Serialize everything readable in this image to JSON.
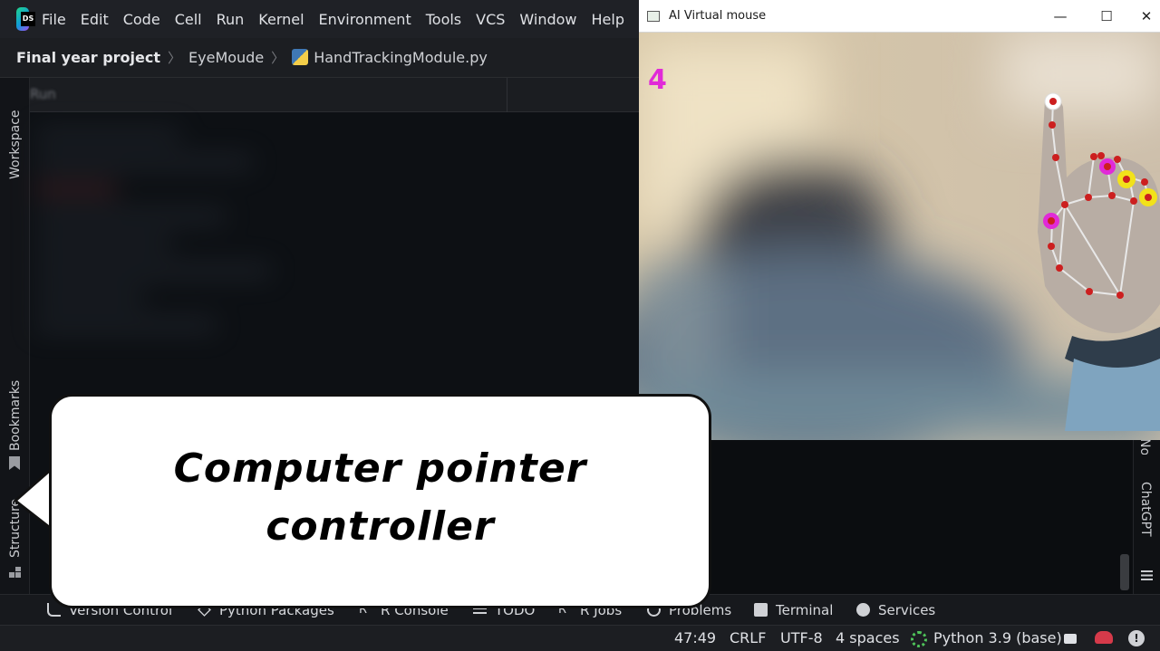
{
  "menubar": {
    "app_icon": "dataspell-logo-icon",
    "items": [
      "File",
      "Edit",
      "Code",
      "Cell",
      "Run",
      "Kernel",
      "Environment",
      "Tools",
      "VCS",
      "Window",
      "Help"
    ]
  },
  "breadcrumb": {
    "project": "Final year project",
    "folder": "EyeMoude",
    "file": "HandTrackingModule.py",
    "file_icon": "python-file-icon"
  },
  "editor": {
    "run_tab": "Run"
  },
  "sidebar_left": {
    "workspace": "Workspace",
    "bookmarks": "Bookmarks",
    "structure": "Structure"
  },
  "sidebar_right": {
    "notifications": "Notifications",
    "chatgpt": "ChatGPT"
  },
  "video_window": {
    "title": "AI Virtual mouse",
    "frame_label": "4",
    "controls": [
      "minimize",
      "maximize",
      "close"
    ]
  },
  "toolbar": {
    "items": [
      {
        "label": "Version Control",
        "icon": "branch-icon"
      },
      {
        "label": "Python Packages",
        "icon": "layers-icon"
      },
      {
        "label": "R Console",
        "icon": "r-console-icon"
      },
      {
        "label": "TODO",
        "icon": "list-icon"
      },
      {
        "label": "R Jobs",
        "icon": "r-jobs-icon"
      },
      {
        "label": "Problems",
        "icon": "problems-icon"
      },
      {
        "label": "Terminal",
        "icon": "terminal-icon"
      },
      {
        "label": "Services",
        "icon": "services-icon"
      }
    ]
  },
  "statusbar": {
    "position": "47:49",
    "line_sep": "CRLF",
    "encoding": "UTF-8",
    "indent": "4 spaces",
    "interpreter": "Python 3.9 (base)"
  },
  "overlay": {
    "caption_line1": "Computer pointer",
    "caption_line2": "controller"
  },
  "colors": {
    "ide_bg": "#0b0d10",
    "landmark_red": "#cc1f1f",
    "landmark_magenta": "#e12ad8",
    "landmark_yellow": "#f2e21a"
  }
}
